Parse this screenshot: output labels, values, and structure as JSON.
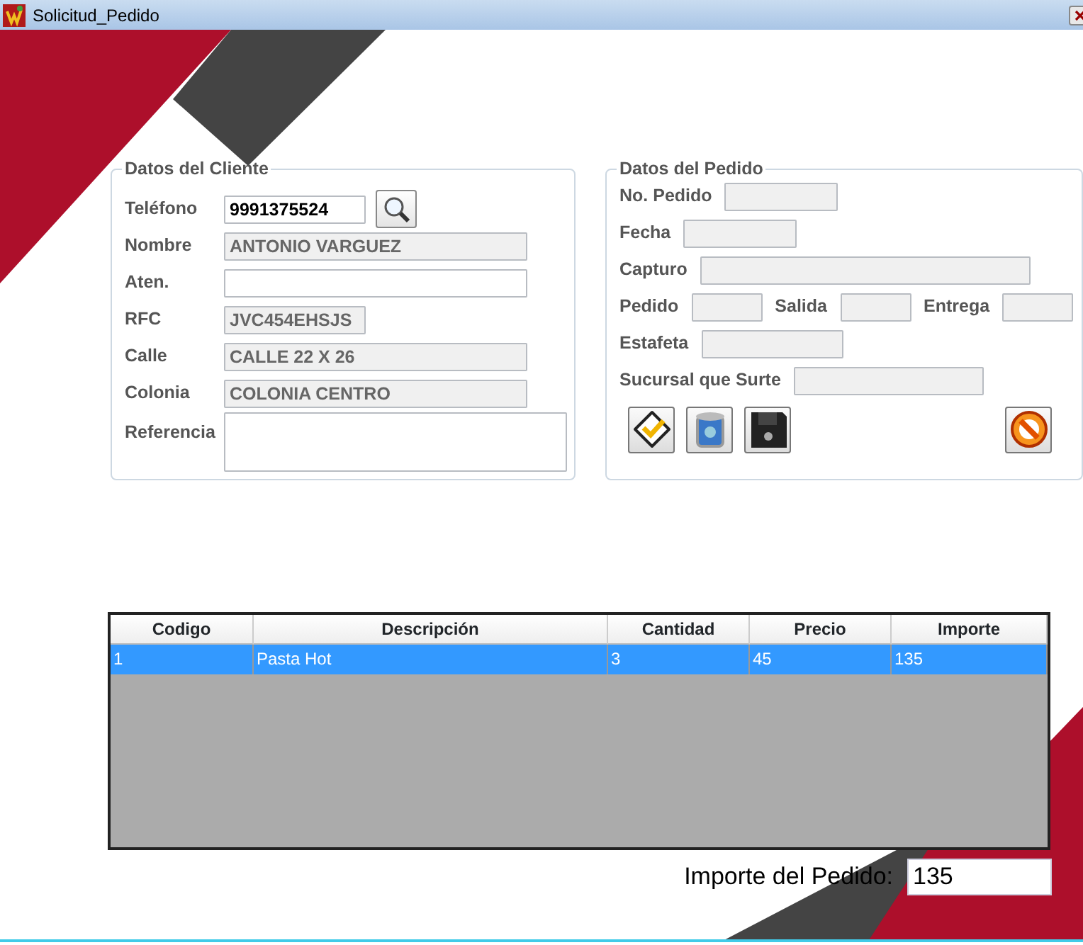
{
  "window": {
    "title": "Solicitud_Pedido"
  },
  "client": {
    "title": "Datos del Cliente",
    "fields": [
      {
        "label": "Teléfono",
        "value": "9991375524",
        "kind": "phone",
        "disabled": false
      },
      {
        "label": "Nombre",
        "value": "ANTONIO VARGUEZ",
        "kind": "wide",
        "disabled": true
      },
      {
        "label": "Aten.",
        "kind": "wide",
        "disabled": false
      },
      {
        "label": "RFC",
        "value": "JVC454EHSJS",
        "kind": "short",
        "disabled": true
      },
      {
        "label": "Calle",
        "value": "CALLE 22 X 26",
        "kind": "wide",
        "disabled": true
      },
      {
        "label": "Colonia",
        "value": "COLONIA CENTRO",
        "kind": "wide",
        "disabled": true
      },
      {
        "label": "Referencia",
        "kind": "textarea",
        "disabled": false
      }
    ]
  },
  "order": {
    "title": "Datos del Pedido",
    "rows": [
      [
        {
          "label": "No. Pedido",
          "disabled": true
        }
      ],
      [
        {
          "label": "Fecha",
          "disabled": true
        }
      ],
      [
        {
          "label": "Capturo",
          "disabled": true
        }
      ],
      [
        {
          "label": "Pedido",
          "disabled": true
        },
        {
          "label": "Salida",
          "disabled": true
        },
        {
          "label": "Entrega",
          "disabled": true
        }
      ],
      [
        {
          "label": "Estafeta",
          "disabled": true
        }
      ],
      [
        {
          "label": "Sucursal que Surte",
          "disabled": true
        }
      ]
    ],
    "buttons": [
      {
        "kind": "accept"
      },
      {
        "kind": "delete"
      },
      {
        "kind": "save"
      },
      {
        "kind": "cancel"
      }
    ]
  },
  "table": {
    "columns": [
      "Codigo",
      "Descripción",
      "Cantidad",
      "Precio",
      "Importe"
    ],
    "rows": [
      {
        "cells": [
          "1",
          "Pasta Hot",
          "3",
          "45",
          "135"
        ],
        "selected": true
      }
    ]
  },
  "total": {
    "label": "Importe del Pedido:",
    "value": "135"
  }
}
